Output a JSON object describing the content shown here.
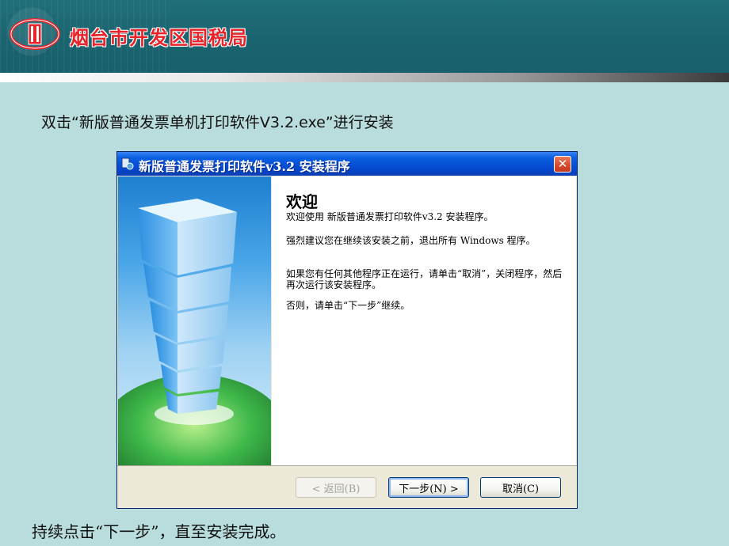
{
  "header": {
    "org_name": "烟台市开发区国税局",
    "emblem_icon": "tax-bureau-emblem-icon"
  },
  "instruction": "双击“新版普通发票单机打印软件V3.2.exe”进行安装",
  "installer": {
    "title": "新版普通发票打印软件v3.2 安装程序",
    "close_label": "✕",
    "welcome_title": "欢迎",
    "paragraphs": [
      "欢迎使用 新版普通发票打印软件v3.2  安装程序。",
      "强烈建议您在继续该安装之前，退出所有 Windows 程序。",
      "如果您有任何其他程序正在运行，请单击“取消”，关闭程序，然后再次运行该安装程序。",
      "否则，请单击“下一步”继续。"
    ],
    "buttons": {
      "back": "< 返回(B)",
      "next": "下一步(N) >",
      "cancel": "取消(C)"
    }
  },
  "footer_note": "持续点击“下一步”，直至安装完成。",
  "colors": {
    "background": "#b9dcdc",
    "header": "#1a6470",
    "org_name": "#e8242a",
    "titlebar": "#0548d0"
  }
}
